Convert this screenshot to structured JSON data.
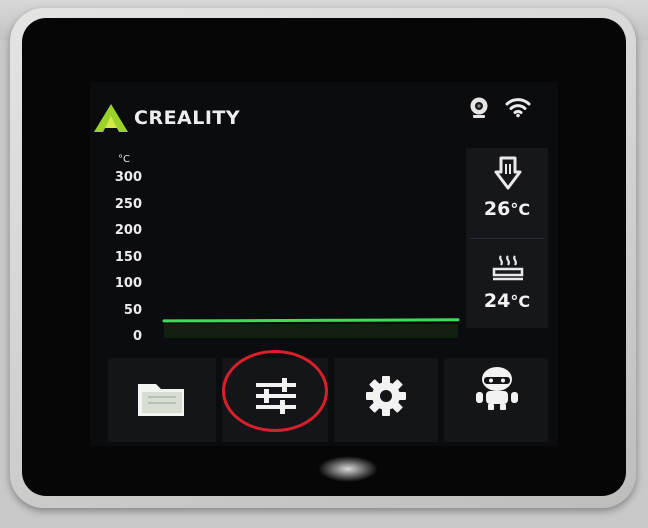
{
  "header": {
    "brand": "CREALITY",
    "brand_color": "#9ad22a",
    "camera_icon": "webcam-icon",
    "wifi_icon": "wifi-icon"
  },
  "temperature_chart": {
    "unit": "°C",
    "ticks": [
      "300",
      "250",
      "200",
      "150",
      "100",
      "50",
      "0"
    ],
    "line_color": "#3ddc5a"
  },
  "chart_data": {
    "type": "line",
    "title": "",
    "xlabel": "",
    "ylabel": "°C",
    "ylim": [
      0,
      300
    ],
    "y_ticks": [
      0,
      50,
      100,
      150,
      200,
      250,
      300
    ],
    "grid": false,
    "series": [
      {
        "values": [
          24,
          24.5,
          25,
          25.5,
          26
        ]
      }
    ]
  },
  "temperatures": {
    "nozzle": {
      "value": "26",
      "unit": "°C",
      "icon": "nozzle-icon"
    },
    "bed": {
      "value": "24",
      "unit": "°C",
      "icon": "heated-bed-icon"
    }
  },
  "nav": {
    "items": [
      {
        "icon": "folder-icon"
      },
      {
        "icon": "sliders-icon",
        "highlighted": true
      },
      {
        "icon": "gear-icon"
      },
      {
        "icon": "robot-icon"
      }
    ]
  },
  "annotation_color": "#d8202a"
}
